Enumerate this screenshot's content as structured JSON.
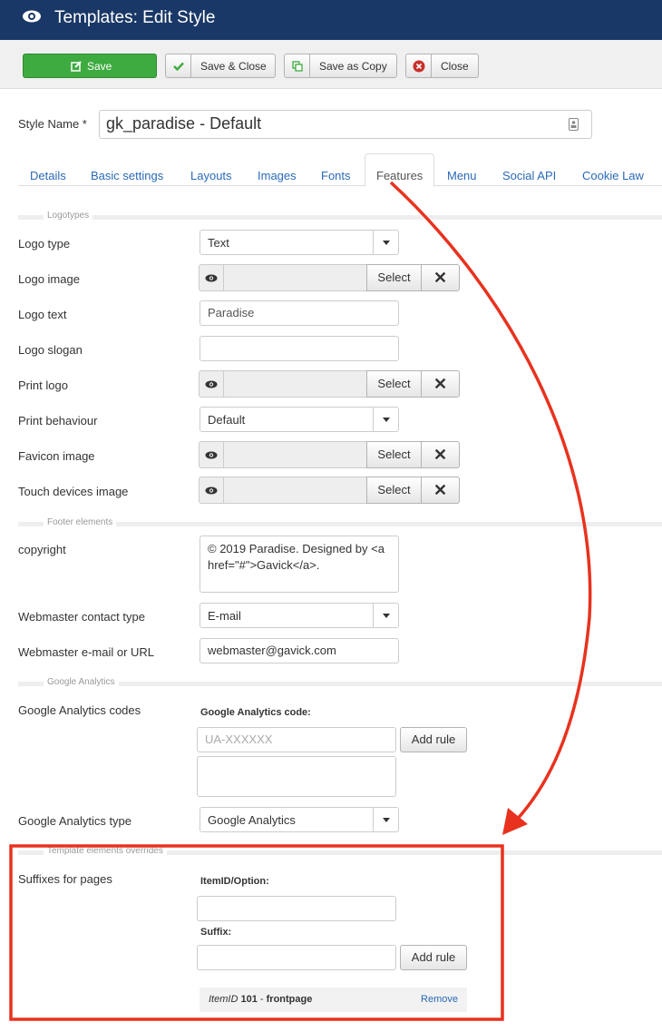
{
  "header": {
    "title": "Templates: Edit Style",
    "icon": "eye-icon"
  },
  "toolbar": {
    "save": "Save",
    "save_close": "Save & Close",
    "save_copy": "Save as Copy",
    "close": "Close"
  },
  "style_name": {
    "label": "Style Name *",
    "value": "gk_paradise - Default"
  },
  "tabs": [
    "Details",
    "Basic settings",
    "Layouts",
    "Images",
    "Fonts",
    "Features",
    "Menu",
    "Social API",
    "Cookie Law"
  ],
  "active_tab": "Features",
  "sections": {
    "logotypes": "Logotypes",
    "footer": "Footer elements",
    "ga": "Google Analytics",
    "overrides": "Template elements overrides"
  },
  "fields": {
    "logo_type": {
      "label": "Logo type",
      "value": "Text"
    },
    "logo_image": {
      "label": "Logo image",
      "button": "Select"
    },
    "logo_text": {
      "label": "Logo text",
      "value": "Paradise"
    },
    "logo_slogan": {
      "label": "Logo slogan",
      "value": ""
    },
    "print_logo": {
      "label": "Print logo",
      "button": "Select"
    },
    "print_behaviour": {
      "label": "Print behaviour",
      "value": "Default"
    },
    "favicon_image": {
      "label": "Favicon image",
      "button": "Select"
    },
    "touch_image": {
      "label": "Touch devices image",
      "button": "Select"
    },
    "copyright": {
      "label": "copyright",
      "value_line1": "© 2019 Paradise. Designed by <a",
      "value_line2": "href=\"#\">Gavick</a>."
    },
    "webmaster_type": {
      "label": "Webmaster contact type",
      "value": "E-mail"
    },
    "webmaster_email": {
      "label": "Webmaster e-mail or URL",
      "value": "webmaster@gavick.com"
    },
    "ga_codes": {
      "label": "Google Analytics codes",
      "sublabel": "Google Analytics code:",
      "placeholder": "UA-XXXXXX",
      "button": "Add rule"
    },
    "ga_type": {
      "label": "Google Analytics type",
      "value": "Google Analytics"
    },
    "suffixes": {
      "label": "Suffixes for pages",
      "itemid_label": "ItemID/Option:",
      "suffix_label": "Suffix:",
      "button": "Add rule",
      "rule_prefix": "ItemID",
      "rule_id": "101",
      "rule_sep": "-",
      "rule_suffix": "frontpage",
      "remove": "Remove"
    }
  },
  "colors": {
    "header_bg": "#1a3867",
    "save_green": "#3eab41",
    "link_blue": "#2a69b8",
    "annotation_red": "#e8321e"
  }
}
